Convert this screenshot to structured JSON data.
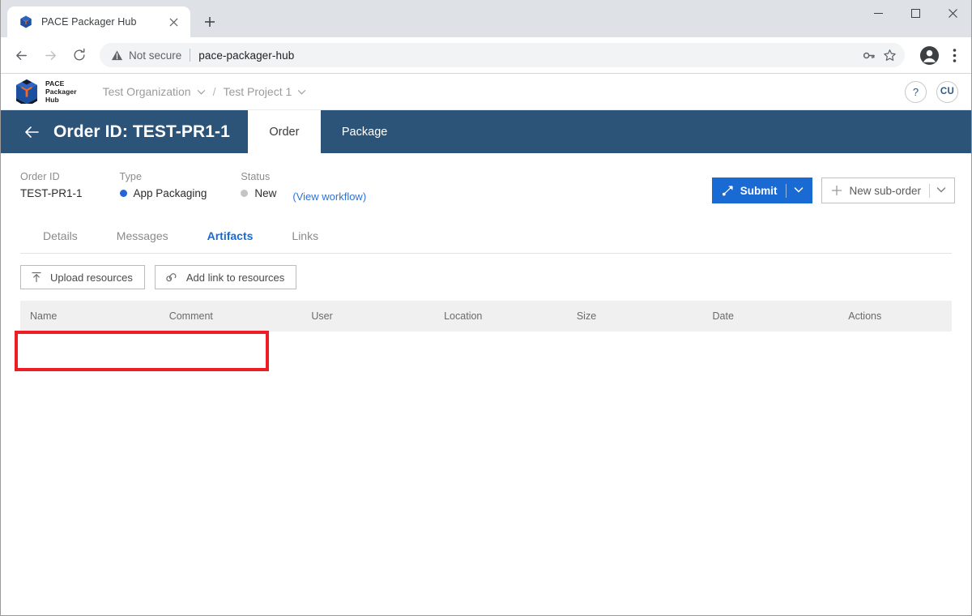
{
  "browser": {
    "tab": {
      "title": "PACE Packager Hub",
      "favicon": "pace-cube-icon",
      "close": "close-tab-icon"
    },
    "new_tab": "new-tab-icon",
    "window_controls": {
      "minimize": "minimize-icon",
      "maximize": "maximize-icon",
      "close": "close-window-icon"
    },
    "nav": {
      "back": "back-arrow-icon",
      "forward": "forward-arrow-icon",
      "reload": "reload-icon"
    },
    "omnibox": {
      "security_label": "Not secure",
      "security_icon": "warning-triangle-icon",
      "url": "pace-packager-hub",
      "key_icon": "password-key-icon",
      "star_icon": "bookmark-star-icon"
    },
    "profile_icon": "profile-avatar-icon",
    "menu_icon": "kebab-menu-icon"
  },
  "app_header": {
    "logo": {
      "icon": "pace-cube-logo",
      "line1": "PACE",
      "line2": "Packager",
      "line3": "Hub"
    },
    "breadcrumb": {
      "organization": "Test Organization",
      "separator": "/",
      "project": "Test Project 1",
      "chevron_icon": "chevron-down-icon"
    },
    "help_label": "?",
    "avatar_label": "CU"
  },
  "order_bar": {
    "back_icon": "back-arrow-icon",
    "title": "Order ID: TEST-PR1-1",
    "tabs": [
      {
        "label": "Order",
        "active": true
      },
      {
        "label": "Package",
        "active": false
      }
    ]
  },
  "order_info": {
    "fields": [
      {
        "label": "Order ID",
        "value": "TEST-PR1-1",
        "dot": null
      },
      {
        "label": "Type",
        "value": "App Packaging",
        "dot": "#2563d9"
      },
      {
        "label": "Status",
        "value": "New",
        "dot": "#c4c4c4"
      }
    ],
    "workflow_link": "(View workflow)"
  },
  "order_actions": {
    "submit": {
      "label": "Submit",
      "icon": "workflow-submit-icon",
      "chevron": "chevron-down-icon"
    },
    "new_suborder": {
      "label": "New sub-order",
      "icon": "plus-icon",
      "chevron": "chevron-down-icon"
    }
  },
  "sub_tabs": [
    {
      "label": "Details",
      "active": false
    },
    {
      "label": "Messages",
      "active": false
    },
    {
      "label": "Artifacts",
      "active": true
    },
    {
      "label": "Links",
      "active": false
    }
  ],
  "artifacts_toolbar": {
    "upload": {
      "label": "Upload resources",
      "icon": "upload-arrow-icon"
    },
    "add_link": {
      "label": "Add link to resources",
      "icon": "link-chain-icon"
    }
  },
  "artifacts_table": {
    "columns": [
      "Name",
      "Comment",
      "User",
      "Location",
      "Size",
      "Date",
      "Actions"
    ],
    "rows": []
  },
  "highlight": {
    "color": "#ee1c25"
  },
  "colors": {
    "header_blue": "#2c5479",
    "accent_blue": "#1a6ad4",
    "link_blue": "#2f72d6",
    "highlight_red": "#ee1c25"
  }
}
